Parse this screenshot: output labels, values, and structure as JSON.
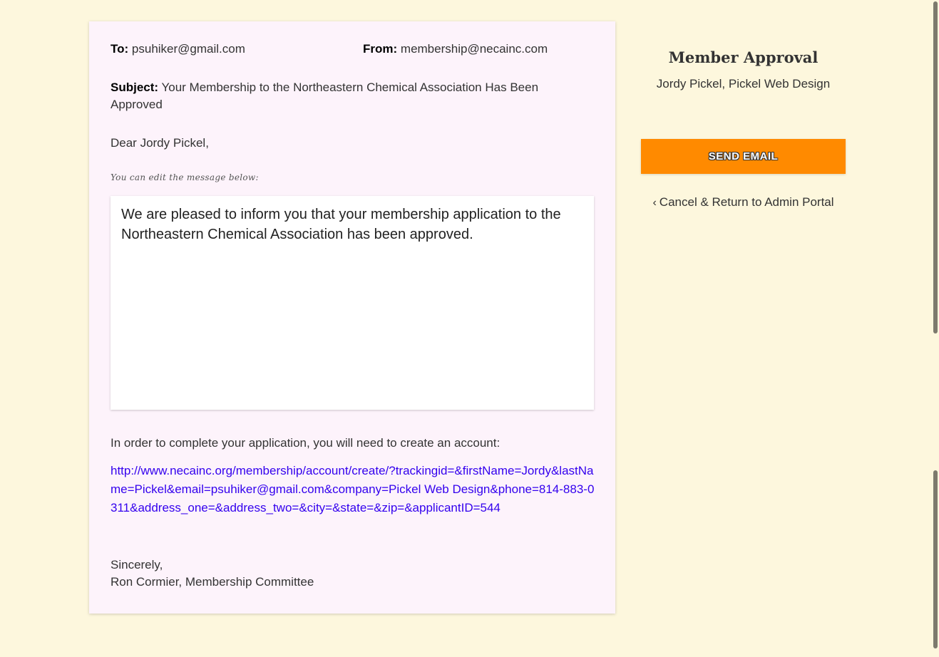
{
  "email": {
    "to_label": "To:",
    "to_value": "psuhiker@gmail.com",
    "from_label": "From:",
    "from_value": "membership@necainc.com",
    "subject_label": "Subject:",
    "subject_value": "Your Membership to the Northeastern Chemical Association Has Been Approved",
    "greeting": "Dear Jordy Pickel,",
    "edit_hint": "You can edit the message below:",
    "message": "We are pleased to inform you that your membership application to the Northeastern Chemical Association has been approved.",
    "instructions": "In order to complete your application, you will need to create an account:",
    "account_link": "http://www.necainc.org/membership/account/create/?trackingid=&firstName=Jordy&lastName=Pickel&email=psuhiker@gmail.com&company=Pickel Web Design&phone=814-883-0311&address_one=&address_two=&city=&state=&zip=&applicantID=544",
    "closing": "Sincerely,",
    "signature": "Ron Cormier, Membership Committee"
  },
  "sidebar": {
    "title": "Member Approval",
    "subtitle": "Jordy Pickel, Pickel Web Design",
    "send_button": "SEND EMAIL",
    "cancel_icon": "chevron-left-icon",
    "cancel_link": "Cancel & Return to Admin Portal"
  },
  "colors": {
    "page_background": "#fdf7dd",
    "card_background": "#fdf3fb",
    "send_button": "#ff8a00",
    "link": "#3300ee"
  }
}
